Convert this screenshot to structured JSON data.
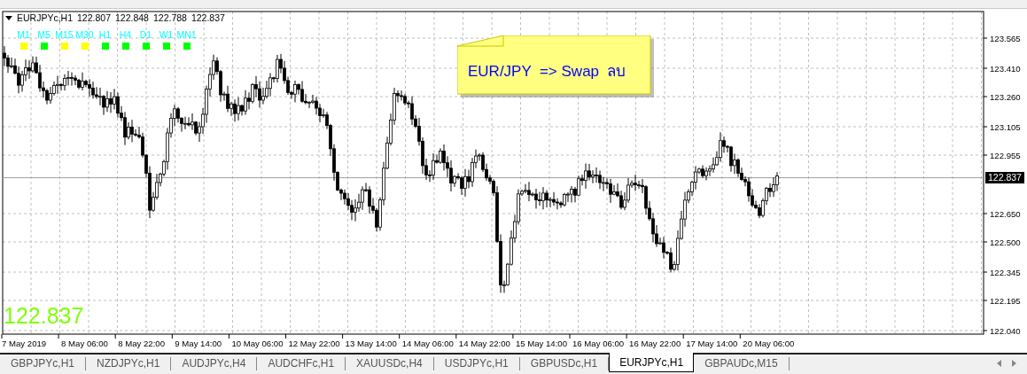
{
  "chart": {
    "symbol": "EURJPYc,H1",
    "ohlc": [
      "122.807",
      "122.848",
      "122.788",
      "122.837"
    ],
    "timeframes": [
      {
        "label": "M1",
        "color": "#ffff00"
      },
      {
        "label": "M5",
        "color": "#00ff00"
      },
      {
        "label": "M15",
        "color": "#ffff00"
      },
      {
        "label": "M30",
        "color": "#ffff00"
      },
      {
        "label": "H1",
        "color": "#00ff00"
      },
      {
        "label": "H4",
        "color": "#00ff00"
      },
      {
        "label": "D1",
        "color": "#00ff00"
      },
      {
        "label": "W1",
        "color": "#00ff00"
      },
      {
        "label": "MN1",
        "color": "#00ff00"
      }
    ],
    "note": "EUR/JPY  => Swap  ลบ",
    "price_scale": [
      "123.565",
      "123.410",
      "123.260",
      "123.105",
      "122.955",
      "122.650",
      "122.500",
      "122.345",
      "122.195",
      "122.040"
    ],
    "current_price": "122.837",
    "time_scale": [
      "7 May 2019",
      "8 May 06:00",
      "8 May 22:00",
      "9 May 14:00",
      "10 May 06:00",
      "12 May 22:00",
      "13 May 14:00",
      "14 May 06:00",
      "14 May 22:00",
      "15 May 14:00",
      "16 May 06:00",
      "16 May 22:00",
      "17 May 14:00",
      "20 May 06:00"
    ],
    "big_price": "122.837"
  },
  "tabs": [
    {
      "label": "GBPJPYc,H1",
      "selected": false
    },
    {
      "label": "NZDJPYc,H1",
      "selected": false
    },
    {
      "label": "AUDJPYc,H4",
      "selected": false
    },
    {
      "label": "AUDCHFc,H1",
      "selected": false
    },
    {
      "label": "XAUUSDc,H4",
      "selected": false
    },
    {
      "label": "USDJPYc,H1",
      "selected": false
    },
    {
      "label": "GBPUSDc,H1",
      "selected": false
    },
    {
      "label": "EURJPYc,H1",
      "selected": true
    },
    {
      "label": "GBPAUDc,M15",
      "selected": false
    }
  ]
}
